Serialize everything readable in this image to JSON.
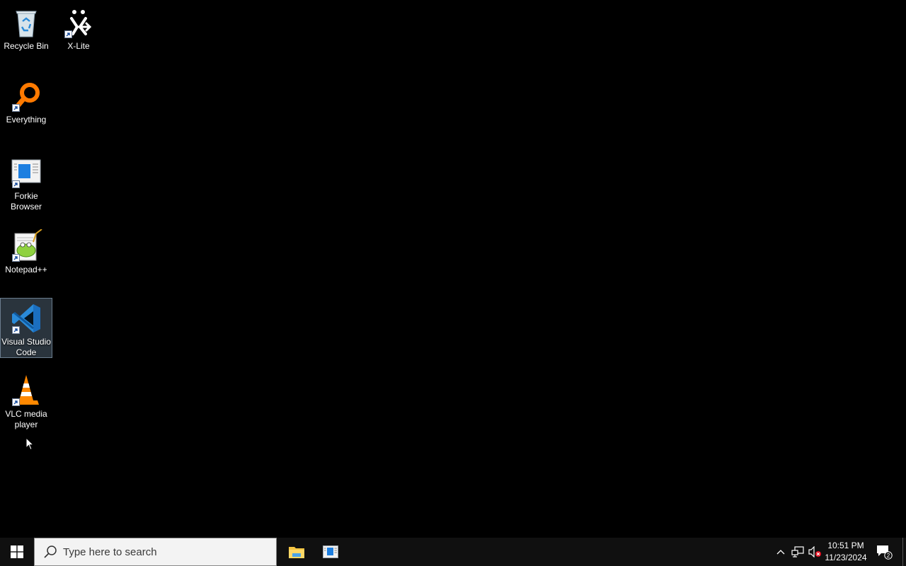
{
  "desktop": {
    "icons": [
      {
        "label": "Recycle Bin",
        "icon": "recycle-bin-icon"
      },
      {
        "label": "X-Lite",
        "icon": "x-lite-icon"
      },
      {
        "label": "Everything",
        "icon": "everything-search-icon"
      },
      {
        "label": "Forkie\nBrowser",
        "icon": "forkie-browser-icon"
      },
      {
        "label": "Notepad++",
        "icon": "notepad-plus-plus-icon"
      },
      {
        "label": "Visual Studio\nCode",
        "icon": "vscode-icon",
        "selected": true
      },
      {
        "label": "VLC media\nplayer",
        "icon": "vlc-icon"
      }
    ]
  },
  "taskbar": {
    "search_placeholder": "Type here to search",
    "pinned": [
      {
        "name": "File Explorer",
        "icon": "folder-icon"
      },
      {
        "name": "Forkie Browser",
        "icon": "browser-icon"
      }
    ],
    "tray": {
      "time": "10:51 PM",
      "date": "11/23/2024",
      "notification_count": "2"
    }
  },
  "colors": {
    "desktop_bg": "#000000",
    "taskbar_bg": "#101010",
    "selection": "#7896af",
    "windows_blue": "#0078d7"
  }
}
